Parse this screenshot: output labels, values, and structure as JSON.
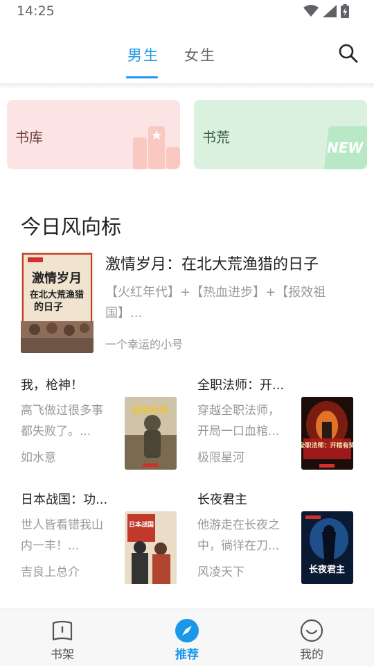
{
  "status": {
    "time": "14:25"
  },
  "header": {
    "tabs": [
      {
        "label": "男生",
        "active": true
      },
      {
        "label": "女生",
        "active": false
      }
    ],
    "accent_color": "#1a97e9"
  },
  "cards": [
    {
      "label": "书库",
      "bg": "#fce4e4"
    },
    {
      "label": "书荒",
      "bg": "#dbf1e0",
      "badge": "NEW"
    }
  ],
  "section": {
    "title": "今日风向标"
  },
  "featured": {
    "title": "激情岁月：在北大荒渔猎的日子",
    "desc": "【火红年代】+【热血进步】+【报效祖国】...",
    "author": "一个幸运的小号",
    "cover_text": [
      "激情岁月",
      "在北大荒渔猎",
      "的日子"
    ]
  },
  "books": [
    {
      "title": "我，枪神！",
      "desc": "高飞做过很多事都失败了。...",
      "author": "如水意",
      "cover_text": "我是枪神"
    },
    {
      "title": "全职法师：开...",
      "desc": "穿越全职法师，开局一口血棺...",
      "author": "极限星河",
      "cover_text": "全职法师：开棺有奖"
    },
    {
      "title": "日本战国：功...",
      "desc": "世人皆看错我山内一丰！...",
      "author": "吉良上总介",
      "cover_text": "日本战国"
    },
    {
      "title": "长夜君主",
      "desc": "他游走在长夜之中，徜徉在刀...",
      "author": "风凌天下",
      "cover_text": "长夜君主"
    }
  ],
  "nav": [
    {
      "label": "书架",
      "icon": "bookshelf-icon",
      "active": false
    },
    {
      "label": "推荐",
      "icon": "compass-icon",
      "active": true
    },
    {
      "label": "我的",
      "icon": "smile-icon",
      "active": false
    }
  ]
}
